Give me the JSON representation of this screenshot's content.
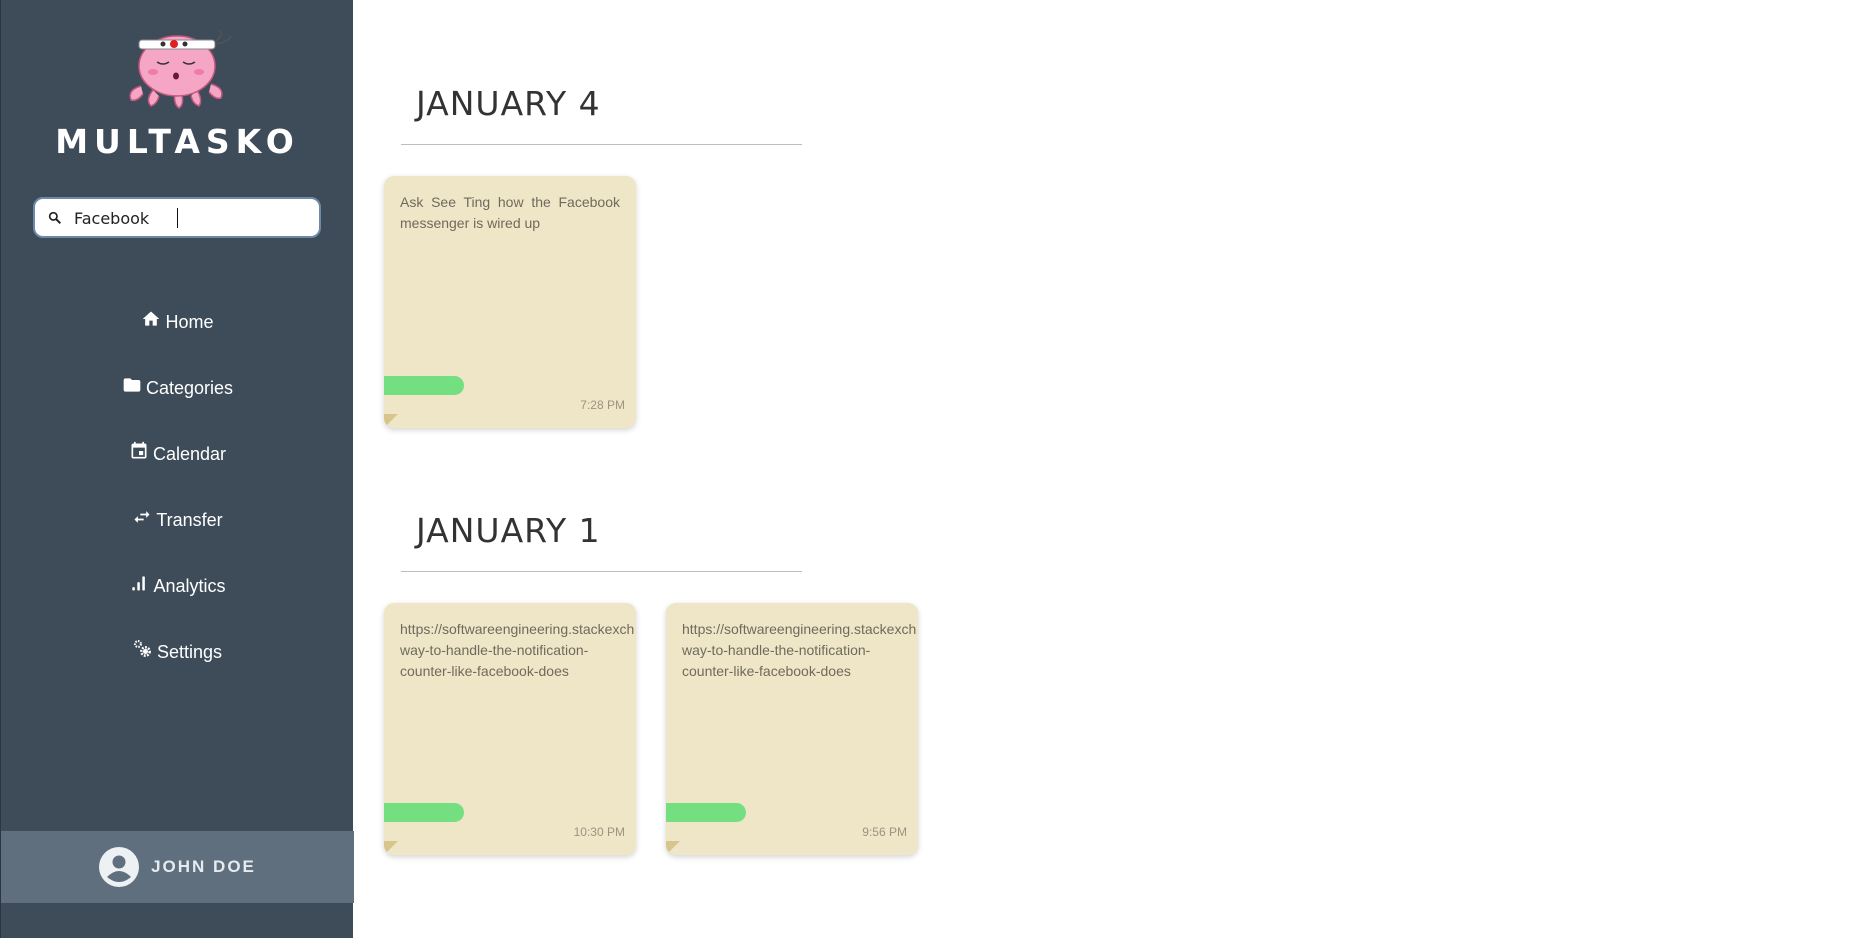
{
  "app": {
    "name": "MULTASKO"
  },
  "search": {
    "value": "Facebook",
    "placeholder": ""
  },
  "nav": [
    {
      "label": "Home",
      "icon": "home-icon"
    },
    {
      "label": "Categories",
      "icon": "folder-icon"
    },
    {
      "label": "Calendar",
      "icon": "calendar-icon"
    },
    {
      "label": "Transfer",
      "icon": "transfer-icon"
    },
    {
      "label": "Analytics",
      "icon": "analytics-icon"
    },
    {
      "label": "Settings",
      "icon": "gears-icon"
    }
  ],
  "user": {
    "name": "JOHN DOE",
    "icon": "account-circle-icon"
  },
  "groups": [
    {
      "date": "JANUARY 4",
      "notes": [
        {
          "text": "Ask See Ting how the Facebook messenger is wired up",
          "time": "7:28 PM",
          "tag_color": "#74df80"
        }
      ]
    },
    {
      "date": "JANUARY 1",
      "notes": [
        {
          "text": "https://softwareengineering.stackexch\nway-to-handle-the-notification-\ncounter-like-facebook-does",
          "time": "10:30 PM",
          "tag_color": "#74df80"
        },
        {
          "text": "https://softwareengineering.stackexch\nway-to-handle-the-notification-\ncounter-like-facebook-does",
          "time": "9:56 PM",
          "tag_color": "#74df80"
        }
      ]
    }
  ],
  "colors": {
    "sidebar": "#3e4c59",
    "user_bar": "#5f6f7e",
    "note_bg": "#efe6c8",
    "tag": "#74df80"
  }
}
